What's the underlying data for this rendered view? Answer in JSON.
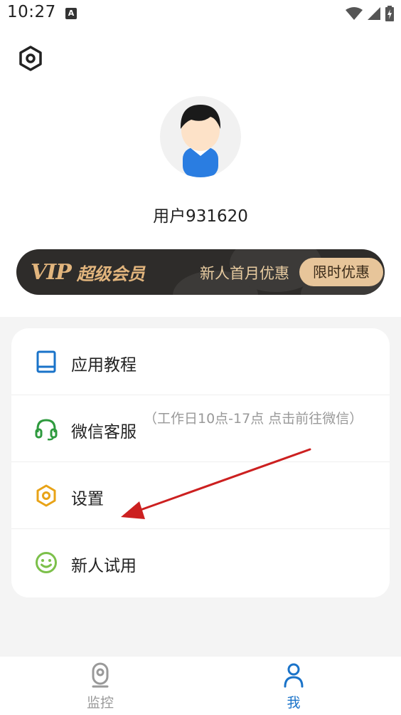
{
  "status_bar": {
    "time": "10:27",
    "notification_letter": "A"
  },
  "profile": {
    "username": "用户931620"
  },
  "vip_banner": {
    "logo_letters": "VIP",
    "logo_text": "超级会员",
    "promo_text": "新人首月优惠",
    "badge_label": "限时优惠",
    "colors": {
      "background": "#2e2c2a",
      "gold": "#e2b57d",
      "badge": "#e7c59a"
    }
  },
  "menu": {
    "items": [
      {
        "label": "应用教程",
        "icon": "book-icon",
        "color": "#1a73c9"
      },
      {
        "label": "微信客服",
        "icon": "headset-icon",
        "color": "#2e9a3e",
        "note": "（工作日10点-17点 点击前往微信）"
      },
      {
        "label": "设置",
        "icon": "hexagon-settings-icon",
        "color": "#e8a317"
      },
      {
        "label": "新人试用",
        "icon": "smiley-icon",
        "color": "#7cc04a"
      }
    ]
  },
  "bottom_nav": {
    "tabs": [
      {
        "label": "监控",
        "icon": "camera-icon",
        "active": false
      },
      {
        "label": "我",
        "icon": "person-icon",
        "active": true
      }
    ],
    "active_color": "#1a73c9",
    "inactive_color": "#999999"
  },
  "annotation": {
    "color": "#cc2020",
    "icon": "red-arrow"
  }
}
